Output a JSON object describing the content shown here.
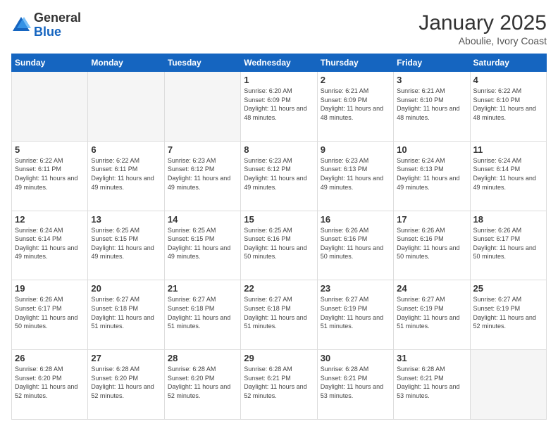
{
  "logo": {
    "general": "General",
    "blue": "Blue"
  },
  "header": {
    "month": "January 2025",
    "location": "Aboulie, Ivory Coast"
  },
  "weekdays": [
    "Sunday",
    "Monday",
    "Tuesday",
    "Wednesday",
    "Thursday",
    "Friday",
    "Saturday"
  ],
  "weeks": [
    [
      {
        "day": "",
        "empty": true
      },
      {
        "day": "",
        "empty": true
      },
      {
        "day": "",
        "empty": true
      },
      {
        "day": "1",
        "sunrise": "6:20 AM",
        "sunset": "6:09 PM",
        "daylight": "11 hours and 48 minutes."
      },
      {
        "day": "2",
        "sunrise": "6:21 AM",
        "sunset": "6:09 PM",
        "daylight": "11 hours and 48 minutes."
      },
      {
        "day": "3",
        "sunrise": "6:21 AM",
        "sunset": "6:10 PM",
        "daylight": "11 hours and 48 minutes."
      },
      {
        "day": "4",
        "sunrise": "6:22 AM",
        "sunset": "6:10 PM",
        "daylight": "11 hours and 48 minutes."
      }
    ],
    [
      {
        "day": "5",
        "sunrise": "6:22 AM",
        "sunset": "6:11 PM",
        "daylight": "11 hours and 49 minutes."
      },
      {
        "day": "6",
        "sunrise": "6:22 AM",
        "sunset": "6:11 PM",
        "daylight": "11 hours and 49 minutes."
      },
      {
        "day": "7",
        "sunrise": "6:23 AM",
        "sunset": "6:12 PM",
        "daylight": "11 hours and 49 minutes."
      },
      {
        "day": "8",
        "sunrise": "6:23 AM",
        "sunset": "6:12 PM",
        "daylight": "11 hours and 49 minutes."
      },
      {
        "day": "9",
        "sunrise": "6:23 AM",
        "sunset": "6:13 PM",
        "daylight": "11 hours and 49 minutes."
      },
      {
        "day": "10",
        "sunrise": "6:24 AM",
        "sunset": "6:13 PM",
        "daylight": "11 hours and 49 minutes."
      },
      {
        "day": "11",
        "sunrise": "6:24 AM",
        "sunset": "6:14 PM",
        "daylight": "11 hours and 49 minutes."
      }
    ],
    [
      {
        "day": "12",
        "sunrise": "6:24 AM",
        "sunset": "6:14 PM",
        "daylight": "11 hours and 49 minutes."
      },
      {
        "day": "13",
        "sunrise": "6:25 AM",
        "sunset": "6:15 PM",
        "daylight": "11 hours and 49 minutes."
      },
      {
        "day": "14",
        "sunrise": "6:25 AM",
        "sunset": "6:15 PM",
        "daylight": "11 hours and 49 minutes."
      },
      {
        "day": "15",
        "sunrise": "6:25 AM",
        "sunset": "6:16 PM",
        "daylight": "11 hours and 50 minutes."
      },
      {
        "day": "16",
        "sunrise": "6:26 AM",
        "sunset": "6:16 PM",
        "daylight": "11 hours and 50 minutes."
      },
      {
        "day": "17",
        "sunrise": "6:26 AM",
        "sunset": "6:16 PM",
        "daylight": "11 hours and 50 minutes."
      },
      {
        "day": "18",
        "sunrise": "6:26 AM",
        "sunset": "6:17 PM",
        "daylight": "11 hours and 50 minutes."
      }
    ],
    [
      {
        "day": "19",
        "sunrise": "6:26 AM",
        "sunset": "6:17 PM",
        "daylight": "11 hours and 50 minutes."
      },
      {
        "day": "20",
        "sunrise": "6:27 AM",
        "sunset": "6:18 PM",
        "daylight": "11 hours and 51 minutes."
      },
      {
        "day": "21",
        "sunrise": "6:27 AM",
        "sunset": "6:18 PM",
        "daylight": "11 hours and 51 minutes."
      },
      {
        "day": "22",
        "sunrise": "6:27 AM",
        "sunset": "6:18 PM",
        "daylight": "11 hours and 51 minutes."
      },
      {
        "day": "23",
        "sunrise": "6:27 AM",
        "sunset": "6:19 PM",
        "daylight": "11 hours and 51 minutes."
      },
      {
        "day": "24",
        "sunrise": "6:27 AM",
        "sunset": "6:19 PM",
        "daylight": "11 hours and 51 minutes."
      },
      {
        "day": "25",
        "sunrise": "6:27 AM",
        "sunset": "6:19 PM",
        "daylight": "11 hours and 52 minutes."
      }
    ],
    [
      {
        "day": "26",
        "sunrise": "6:28 AM",
        "sunset": "6:20 PM",
        "daylight": "11 hours and 52 minutes."
      },
      {
        "day": "27",
        "sunrise": "6:28 AM",
        "sunset": "6:20 PM",
        "daylight": "11 hours and 52 minutes."
      },
      {
        "day": "28",
        "sunrise": "6:28 AM",
        "sunset": "6:20 PM",
        "daylight": "11 hours and 52 minutes."
      },
      {
        "day": "29",
        "sunrise": "6:28 AM",
        "sunset": "6:21 PM",
        "daylight": "11 hours and 52 minutes."
      },
      {
        "day": "30",
        "sunrise": "6:28 AM",
        "sunset": "6:21 PM",
        "daylight": "11 hours and 53 minutes."
      },
      {
        "day": "31",
        "sunrise": "6:28 AM",
        "sunset": "6:21 PM",
        "daylight": "11 hours and 53 minutes."
      },
      {
        "day": "",
        "empty": true
      }
    ]
  ]
}
